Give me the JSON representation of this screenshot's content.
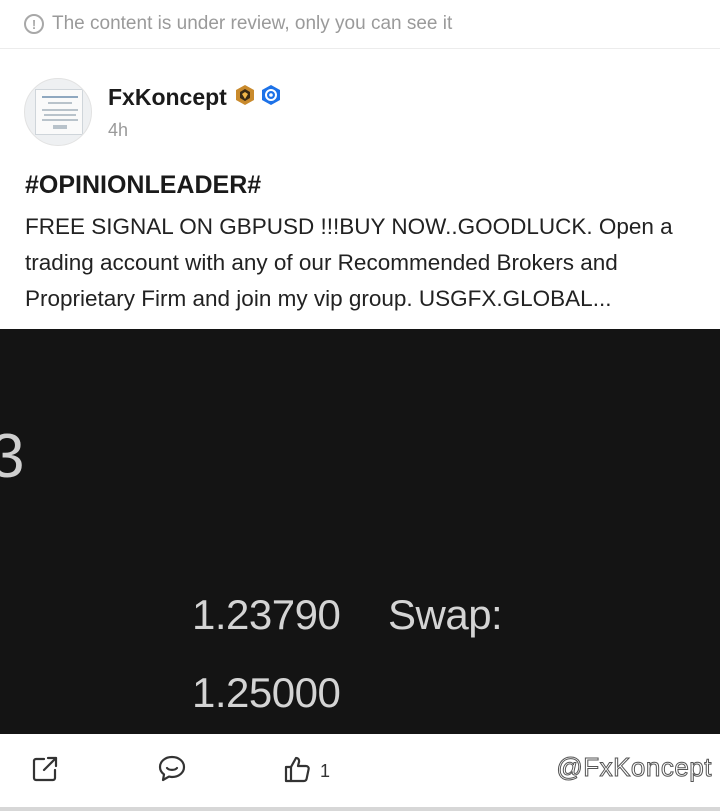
{
  "review_notice": {
    "text": "The content is under review, only you can see it",
    "icon": "info-icon"
  },
  "author": {
    "name": "FxKoncept",
    "time": "4h",
    "avatar": "certificate-image",
    "badges": [
      "pro-badge-icon",
      "verified-badge-icon"
    ],
    "badge_colors": [
      "#c98a2c",
      "#1d72e8"
    ]
  },
  "post": {
    "hashtag": "#OPINIONLEADER#",
    "text": "FREE SIGNAL ON GBPUSD !!!BUY NOW..GOODLUCK. Open a trading account with any of our Recommended Brokers and Proprietary Firm and join my vip group. USGFX.GLOBAL..."
  },
  "image": {
    "edge_glyph": "3",
    "price_1": "1.23790",
    "swap_label": "Swap:",
    "price_2": "1.25000"
  },
  "actions": {
    "share_icon": "share-icon",
    "comment_icon": "comment-icon",
    "like_icon": "thumbs-up-icon",
    "like_count": "1"
  },
  "watermark": "@FxKoncept"
}
